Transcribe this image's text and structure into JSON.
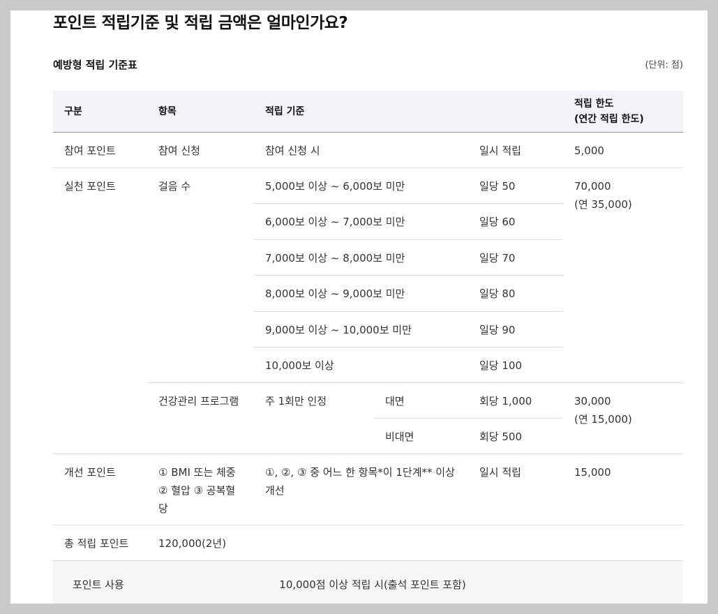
{
  "title": "포인트 적립기준 및 적립 금액은 얼마인가요?",
  "subtitle": "예방형 적립 기준표",
  "unit": "(단위: 점)",
  "headers": [
    "구분",
    "항목",
    "적립 기준",
    "적립 한도",
    "(연간 적립 한도)"
  ],
  "participation": {
    "category": "참여 포인트",
    "item": "참여 신청",
    "criteria": "참여 신청 시",
    "earn": "일시 적립",
    "limit": "5,000"
  },
  "practice": {
    "category": "실천 포인트",
    "steps": {
      "item": "걸음 수",
      "limit": "70,000",
      "limit_annual": "(연 35,000)",
      "rows": [
        {
          "criteria": "5,000보 이상 ~ 6,000보 미만",
          "earn": "일당 50"
        },
        {
          "criteria": "6,000보 이상 ~ 7,000보 미만",
          "earn": "일당 60"
        },
        {
          "criteria": "7,000보 이상 ~ 8,000보 미만",
          "earn": "일당 70"
        },
        {
          "criteria": "8,000보 이상 ~ 9,000보 미만",
          "earn": "일당 80"
        },
        {
          "criteria": "9,000보 이상 ~ 10,000보 미만",
          "earn": "일당 90"
        },
        {
          "criteria": "10,000보 이상",
          "earn": "일당 100"
        }
      ]
    },
    "program": {
      "item": "건강관리 프로그램",
      "criteria": "주 1회만 인정",
      "limit": "30,000",
      "limit_annual": "(연 15,000)",
      "rows": [
        {
          "mode": "대면",
          "earn": "회당 1,000"
        },
        {
          "mode": "비대면",
          "earn": "회당 500"
        }
      ]
    }
  },
  "improvement": {
    "category": "개선 포인트",
    "item": "① BMI 또는 체중 ② 혈압 ③ 공복혈당",
    "criteria": "①, ②, ③ 중 어느 한 항목*이 1단계** 이상 개선",
    "earn": "일시 적립",
    "limit": "15,000"
  },
  "total": {
    "label": "총 적립 포인트",
    "value": "120,000(2년)"
  },
  "usage": {
    "label": "포인트 사용",
    "value": "10,000점 이상 적립 시(출석 포인트 포함)"
  }
}
